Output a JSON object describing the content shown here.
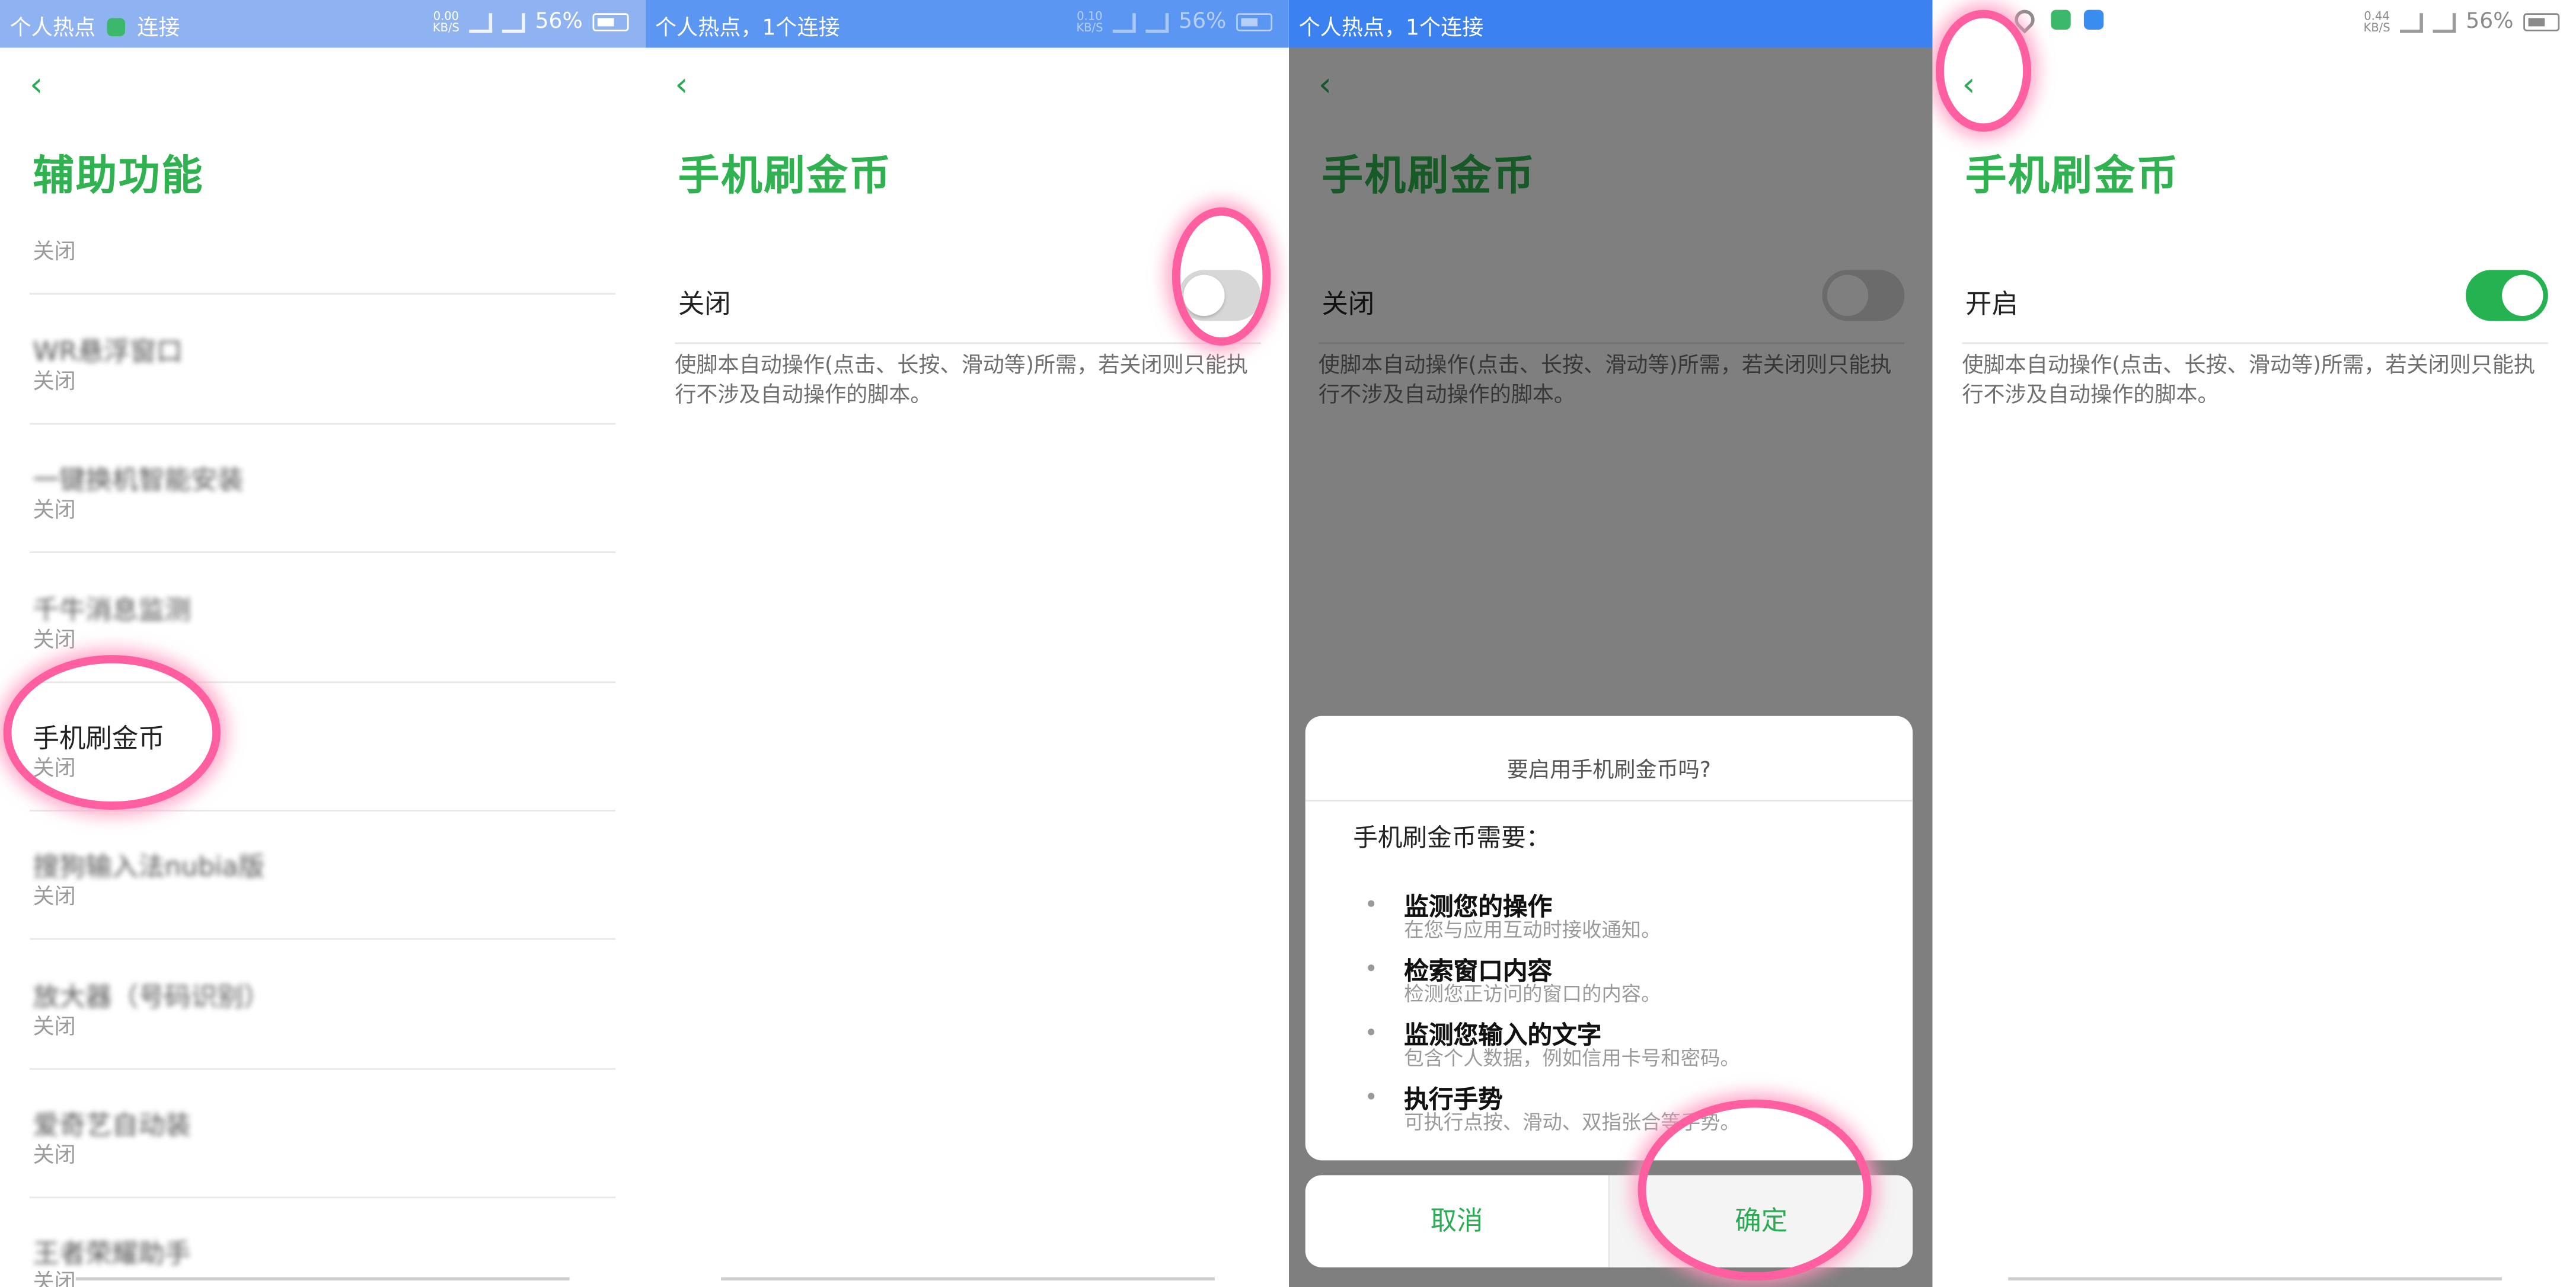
{
  "colors": {
    "accent": "#2fb24f",
    "switch_on": "#24b350",
    "switch_off": "#d7d7d7",
    "highlight": "#ff5fa0"
  },
  "icons": {
    "back": "chevron-left",
    "battery": "battery",
    "signal": "signal-bars"
  },
  "statusbar": {
    "hotspot_full": "个人热点，1个连接",
    "hotspot_short": "个人热点",
    "connect": "连接",
    "speed_0": "0.00",
    "speed_1": "0.10",
    "speed_3": "0.44",
    "speed_unit": "KB/S",
    "battery": "56%"
  },
  "screen1": {
    "title": "辅助功能",
    "top_status": "关闭",
    "items": [
      {
        "name": "WR悬浮窗口",
        "status": "关闭"
      },
      {
        "name": "一键换机智能安装",
        "status": "关闭"
      },
      {
        "name": "千牛消息监测",
        "status": "关闭"
      },
      {
        "name": "手机刷金币",
        "status": "关闭"
      },
      {
        "name": "搜狗输入法nubia版",
        "status": "关闭"
      },
      {
        "name": "放大器（号码识别）",
        "status": "关闭"
      },
      {
        "name": "爱奇艺自动装",
        "status": "关闭"
      },
      {
        "name": "王者荣耀助手",
        "status": "关闭"
      }
    ]
  },
  "screen2": {
    "title": "手机刷金币",
    "toggle_label": "关闭",
    "desc": "使脚本自动操作(点击、长按、滑动等)所需，若关闭则只能执行不涉及自动操作的脚本。"
  },
  "screen3": {
    "title": "手机刷金币",
    "toggle_label": "关闭",
    "desc": "使脚本自动操作(点击、长按、滑动等)所需，若关闭则只能执行不涉及自动操作的脚本。",
    "dialog": {
      "question": "要启用手机刷金币吗?",
      "needs": "手机刷金币需要：",
      "permissions": [
        {
          "title": "监测您的操作",
          "desc": "在您与应用互动时接收通知。"
        },
        {
          "title": "检索窗口内容",
          "desc": "检测您正访问的窗口的内容。"
        },
        {
          "title": "监测您输入的文字",
          "desc": "包含个人数据，例如信用卡号和密码。"
        },
        {
          "title": "执行手势",
          "desc": "可执行点按、滑动、双指张合等手势。"
        }
      ],
      "cancel": "取消",
      "confirm": "确定"
    }
  },
  "screen4": {
    "title": "手机刷金币",
    "toggle_label": "开启",
    "toggle_on": true,
    "desc": "使脚本自动操作(点击、长按、滑动等)所需，若关闭则只能执行不涉及自动操作的脚本。"
  }
}
